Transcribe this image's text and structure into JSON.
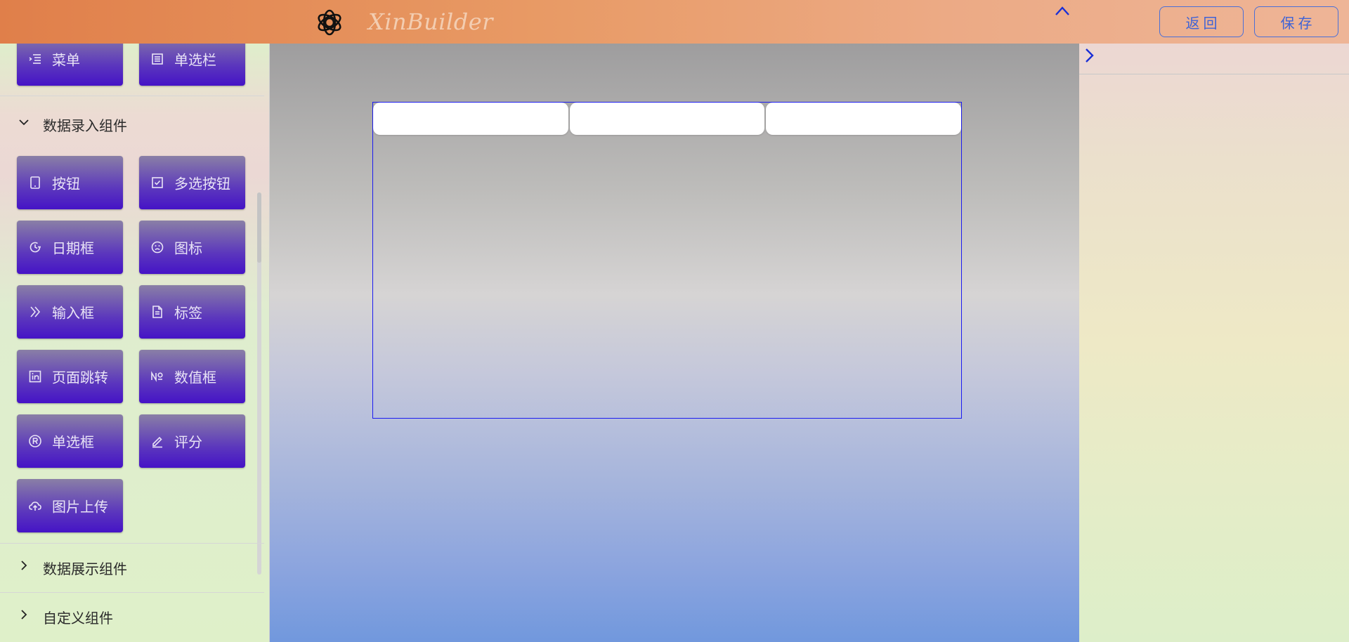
{
  "app": {
    "title": "XinBuilder",
    "logo_icon": "openai-knot-logo-icon"
  },
  "header": {
    "back_label": "返回",
    "save_label": "保存",
    "collapse_icon": "chevron-up-icon"
  },
  "colors": {
    "header_start": "#e07f4a",
    "header_end": "#eeb597",
    "component_button_top": "#8a7fa6",
    "component_button_bottom": "#4513c6",
    "action_button_border": "#4a6fd8",
    "frame_border": "#1b1bf0",
    "canvas_bottom": "#7198dd"
  },
  "sidebar": {
    "top_items": [
      {
        "label": "菜单",
        "icon": "indent-list-icon"
      },
      {
        "label": "单选栏",
        "icon": "layout-panel-icon"
      }
    ],
    "sections": [
      {
        "label": "数据录入组件",
        "expanded": true,
        "items": [
          {
            "label": "按钮",
            "icon": "tablet-icon"
          },
          {
            "label": "多选按钮",
            "icon": "checkbox-icon"
          },
          {
            "label": "日期框",
            "icon": "clock-history-icon"
          },
          {
            "label": "图标",
            "icon": "sad-face-icon"
          },
          {
            "label": "输入框",
            "icon": "double-chevron-right-icon"
          },
          {
            "label": "标签",
            "icon": "file-text-icon"
          },
          {
            "label": "页面跳转",
            "icon": "linkedin-icon"
          },
          {
            "label": "数值框",
            "icon": "numero-icon"
          },
          {
            "label": "单选框",
            "icon": "registered-icon"
          },
          {
            "label": "评分",
            "icon": "edit-pen-icon"
          },
          {
            "label": "图片上传",
            "icon": "cloud-upload-icon"
          }
        ]
      },
      {
        "label": "数据展示组件",
        "expanded": false
      },
      {
        "label": "自定义组件",
        "expanded": false
      }
    ]
  },
  "canvas": {
    "frame_cells": 3
  },
  "right_panel": {
    "expand_icon": "chevron-right-icon"
  }
}
